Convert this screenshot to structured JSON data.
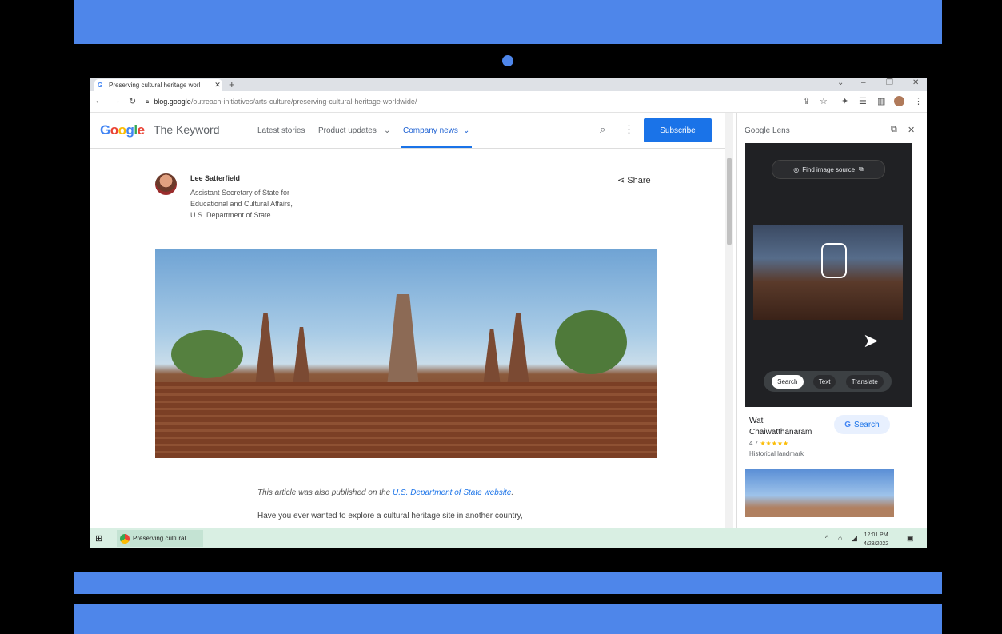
{
  "tab": {
    "title": "Preserving cultural heritage worl",
    "close": "✕",
    "new_tab": "+"
  },
  "window_controls": [
    "⌄",
    "–",
    "❐",
    "✕"
  ],
  "address": {
    "host": "blog.google",
    "path": "/outreach-initiatives/arts-culture/preserving-cultural-heritage-worldwide/"
  },
  "site": {
    "logo": "Google",
    "name": "The Keyword",
    "nav": [
      "Latest stories",
      "Product updates",
      "Company news"
    ],
    "subscribe": "Subscribe"
  },
  "article": {
    "author": "Lee Satterfield",
    "role": "Assistant Secretary of State for Educational and Cultural Affairs, U.S. Department of State",
    "share": "Share",
    "caption_pre": "This article was also published on the ",
    "caption_link": "U.S. Department of State website",
    "caption_post": ".",
    "paragraph": "Have you ever wanted to explore a cultural heritage site in another country,"
  },
  "lens": {
    "header": "Google Lens",
    "find_source": "Find image source",
    "modes": [
      "Search",
      "Text",
      "Translate"
    ],
    "result_name": "Wat Chaiwatthanaram",
    "rating": "4.7",
    "stars": "★★★★★",
    "result_type": "Historical landmark",
    "search_button": "Search"
  },
  "taskbar": {
    "app_label": "Preserving cultural ...",
    "time": "12:01 PM",
    "date": "4/28/2022"
  },
  "colors": {
    "accent": "#1a73e8",
    "frame_blue": "#4e86ea"
  }
}
